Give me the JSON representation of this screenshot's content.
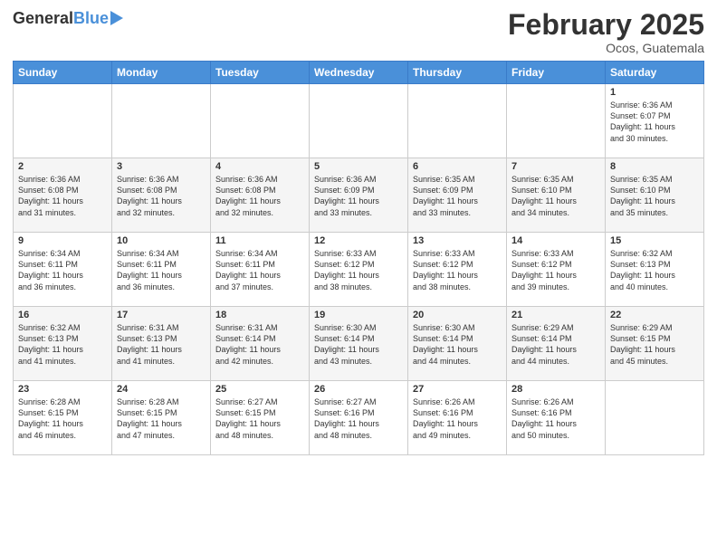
{
  "logo": {
    "general": "General",
    "blue": "Blue"
  },
  "header": {
    "month_year": "February 2025",
    "location": "Ocos, Guatemala"
  },
  "weekdays": [
    "Sunday",
    "Monday",
    "Tuesday",
    "Wednesday",
    "Thursday",
    "Friday",
    "Saturday"
  ],
  "weeks": [
    [
      {
        "day": "",
        "info": ""
      },
      {
        "day": "",
        "info": ""
      },
      {
        "day": "",
        "info": ""
      },
      {
        "day": "",
        "info": ""
      },
      {
        "day": "",
        "info": ""
      },
      {
        "day": "",
        "info": ""
      },
      {
        "day": "1",
        "info": "Sunrise: 6:36 AM\nSunset: 6:07 PM\nDaylight: 11 hours\nand 30 minutes."
      }
    ],
    [
      {
        "day": "2",
        "info": "Sunrise: 6:36 AM\nSunset: 6:08 PM\nDaylight: 11 hours\nand 31 minutes."
      },
      {
        "day": "3",
        "info": "Sunrise: 6:36 AM\nSunset: 6:08 PM\nDaylight: 11 hours\nand 32 minutes."
      },
      {
        "day": "4",
        "info": "Sunrise: 6:36 AM\nSunset: 6:08 PM\nDaylight: 11 hours\nand 32 minutes."
      },
      {
        "day": "5",
        "info": "Sunrise: 6:36 AM\nSunset: 6:09 PM\nDaylight: 11 hours\nand 33 minutes."
      },
      {
        "day": "6",
        "info": "Sunrise: 6:35 AM\nSunset: 6:09 PM\nDaylight: 11 hours\nand 33 minutes."
      },
      {
        "day": "7",
        "info": "Sunrise: 6:35 AM\nSunset: 6:10 PM\nDaylight: 11 hours\nand 34 minutes."
      },
      {
        "day": "8",
        "info": "Sunrise: 6:35 AM\nSunset: 6:10 PM\nDaylight: 11 hours\nand 35 minutes."
      }
    ],
    [
      {
        "day": "9",
        "info": "Sunrise: 6:34 AM\nSunset: 6:11 PM\nDaylight: 11 hours\nand 36 minutes."
      },
      {
        "day": "10",
        "info": "Sunrise: 6:34 AM\nSunset: 6:11 PM\nDaylight: 11 hours\nand 36 minutes."
      },
      {
        "day": "11",
        "info": "Sunrise: 6:34 AM\nSunset: 6:11 PM\nDaylight: 11 hours\nand 37 minutes."
      },
      {
        "day": "12",
        "info": "Sunrise: 6:33 AM\nSunset: 6:12 PM\nDaylight: 11 hours\nand 38 minutes."
      },
      {
        "day": "13",
        "info": "Sunrise: 6:33 AM\nSunset: 6:12 PM\nDaylight: 11 hours\nand 38 minutes."
      },
      {
        "day": "14",
        "info": "Sunrise: 6:33 AM\nSunset: 6:12 PM\nDaylight: 11 hours\nand 39 minutes."
      },
      {
        "day": "15",
        "info": "Sunrise: 6:32 AM\nSunset: 6:13 PM\nDaylight: 11 hours\nand 40 minutes."
      }
    ],
    [
      {
        "day": "16",
        "info": "Sunrise: 6:32 AM\nSunset: 6:13 PM\nDaylight: 11 hours\nand 41 minutes."
      },
      {
        "day": "17",
        "info": "Sunrise: 6:31 AM\nSunset: 6:13 PM\nDaylight: 11 hours\nand 41 minutes."
      },
      {
        "day": "18",
        "info": "Sunrise: 6:31 AM\nSunset: 6:14 PM\nDaylight: 11 hours\nand 42 minutes."
      },
      {
        "day": "19",
        "info": "Sunrise: 6:30 AM\nSunset: 6:14 PM\nDaylight: 11 hours\nand 43 minutes."
      },
      {
        "day": "20",
        "info": "Sunrise: 6:30 AM\nSunset: 6:14 PM\nDaylight: 11 hours\nand 44 minutes."
      },
      {
        "day": "21",
        "info": "Sunrise: 6:29 AM\nSunset: 6:14 PM\nDaylight: 11 hours\nand 44 minutes."
      },
      {
        "day": "22",
        "info": "Sunrise: 6:29 AM\nSunset: 6:15 PM\nDaylight: 11 hours\nand 45 minutes."
      }
    ],
    [
      {
        "day": "23",
        "info": "Sunrise: 6:28 AM\nSunset: 6:15 PM\nDaylight: 11 hours\nand 46 minutes."
      },
      {
        "day": "24",
        "info": "Sunrise: 6:28 AM\nSunset: 6:15 PM\nDaylight: 11 hours\nand 47 minutes."
      },
      {
        "day": "25",
        "info": "Sunrise: 6:27 AM\nSunset: 6:15 PM\nDaylight: 11 hours\nand 48 minutes."
      },
      {
        "day": "26",
        "info": "Sunrise: 6:27 AM\nSunset: 6:16 PM\nDaylight: 11 hours\nand 48 minutes."
      },
      {
        "day": "27",
        "info": "Sunrise: 6:26 AM\nSunset: 6:16 PM\nDaylight: 11 hours\nand 49 minutes."
      },
      {
        "day": "28",
        "info": "Sunrise: 6:26 AM\nSunset: 6:16 PM\nDaylight: 11 hours\nand 50 minutes."
      },
      {
        "day": "",
        "info": ""
      }
    ]
  ]
}
